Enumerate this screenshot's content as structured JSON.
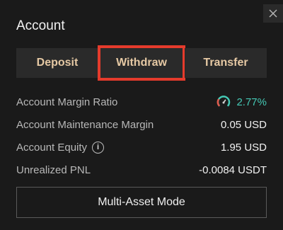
{
  "panel": {
    "title": "Account",
    "close_icon": "close-icon"
  },
  "tabs": [
    {
      "label": "Deposit",
      "active": false
    },
    {
      "label": "Withdraw",
      "active": true
    },
    {
      "label": "Transfer",
      "active": false
    }
  ],
  "rows": {
    "margin_ratio": {
      "label": "Account Margin Ratio",
      "value": "2.77%",
      "icon": "gauge-icon"
    },
    "maintenance_margin": {
      "label": "Account Maintenance Margin",
      "value": "0.05 USD"
    },
    "equity": {
      "label": "Account Equity",
      "value": "1.95 USD",
      "info_icon": "info-icon",
      "info_glyph": "i"
    },
    "unrealized_pnl": {
      "label": "Unrealized PNL",
      "value": "-0.0084 USDT"
    }
  },
  "mode_button": {
    "label": "Multi-Asset Mode"
  },
  "colors": {
    "accent": "#e6c9a4",
    "highlight": "#e53b2c",
    "teal": "#45c9b5"
  }
}
